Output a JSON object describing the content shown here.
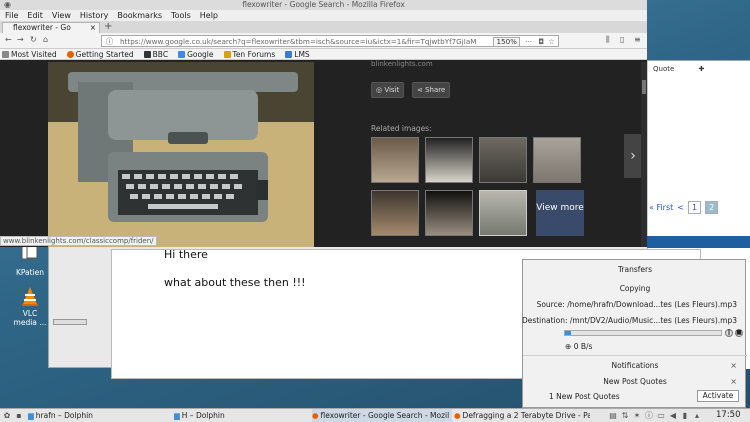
{
  "desktop": {
    "icons": [
      {
        "label": "KPatien"
      },
      {
        "label": "VLC media ..."
      }
    ]
  },
  "firefox": {
    "window_title": "flexowriter - Google Search - Mozilla Firefox",
    "menu": [
      "File",
      "Edit",
      "View",
      "History",
      "Bookmarks",
      "Tools",
      "Help"
    ],
    "tab_label": "flexowriter - Go",
    "new_tab": "+",
    "url": "https://www.google.co.uk/search?q=flexowriter&tbm=isch&source=iu&ictx=1&fir=TqjwtbYf7GjIaM",
    "zoom": "150%",
    "bookmarks": [
      {
        "label": "Most Visited",
        "color": "#888888"
      },
      {
        "label": "Getting Started",
        "color": "#e66000"
      },
      {
        "label": "BBC",
        "color": "#333333"
      },
      {
        "label": "Google",
        "color": "#4285f4"
      },
      {
        "label": "Ten Forums",
        "color": "#d9a400"
      },
      {
        "label": "LMS",
        "color": "#3a7bd5"
      }
    ],
    "image_source": "blinkenlights.com",
    "visit_label": "Visit",
    "share_label": "Share",
    "related_label": "Related images:",
    "view_more": "View more",
    "status_url": "www.blinkenlights.com/classiccomp/friden/"
  },
  "forum": {
    "quote_label": "Quote",
    "pager": {
      "first": "First",
      "prev": "1",
      "current": "2"
    },
    "editor_lines": [
      "Hi there",
      "what about these then !!!"
    ]
  },
  "transfers": {
    "title": "Transfers",
    "status": "Copying",
    "source_label": "Source:",
    "source": "/home/hrafn/Download...tes (Les Fleurs).mp3",
    "destination_label": "Destination:",
    "destination": "/mnt/DV2/Audio/Music...tes (Les Fleurs).mp3",
    "speed": "0 B/s",
    "progress": 0.04,
    "notifications_title": "Notifications",
    "group_title": "New Post Quotes",
    "item": "1 New Post Quotes",
    "activate_label": "Activate"
  },
  "taskbar": {
    "tasks": [
      {
        "label": "hrafn – Dolphin"
      },
      {
        "label": "H – Dolphin"
      },
      {
        "label": "flexowriter - Google Search - Mozil"
      },
      {
        "label": "Defragging a 2 Terabyte Drive - Pa"
      }
    ],
    "clock": "17:50"
  },
  "colors": {
    "accent": "#3f8fd6",
    "firefox_dark": "#222222"
  }
}
